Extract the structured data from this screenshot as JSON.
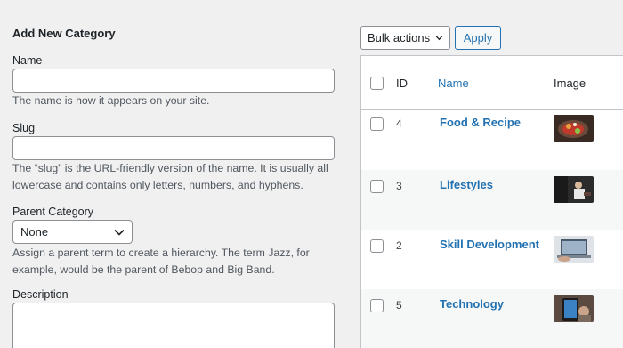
{
  "form": {
    "title": "Add New Category",
    "name_label": "Name",
    "name_value": "",
    "name_help": "The name is how it appears on your site.",
    "slug_label": "Slug",
    "slug_value": "",
    "slug_help": "The “slug” is the URL-friendly version of the name. It is usually all lowercase and contains only letters, numbers, and hyphens.",
    "parent_label": "Parent Category",
    "parent_selected": "None",
    "parent_help": "Assign a parent term to create a hierarchy. The term Jazz, for example, would be the parent of Bebop and Big Band.",
    "description_label": "Description",
    "description_value": ""
  },
  "toolbar": {
    "bulk_label": "Bulk actions",
    "apply_label": "Apply"
  },
  "table": {
    "headers": {
      "id": "ID",
      "name": "Name",
      "image": "Image"
    },
    "rows": [
      {
        "id": "4",
        "name": "Food & Recipe",
        "image_icon": "food-thumbnail"
      },
      {
        "id": "3",
        "name": "Lifestyles",
        "image_icon": "lifestyle-thumbnail"
      },
      {
        "id": "2",
        "name": "Skill Development",
        "image_icon": "skill-thumbnail"
      },
      {
        "id": "5",
        "name": "Technology",
        "image_icon": "technology-thumbnail"
      }
    ]
  },
  "colors": {
    "link": "#2271b1",
    "background": "#f0f0f1",
    "border": "#8c8f94"
  }
}
